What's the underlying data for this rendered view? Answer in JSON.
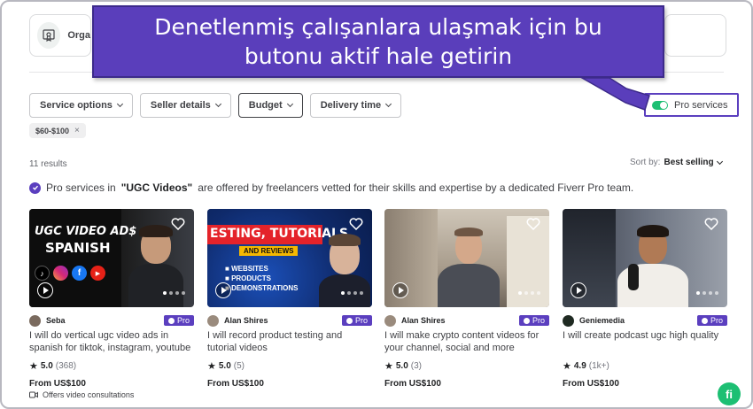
{
  "callout": {
    "line1": "Denetlenmiş çalışanlara ulaşmak için bu",
    "line2": "butonu aktif hale getirin"
  },
  "category_card": {
    "label": "Orga",
    "icon": "certificate-icon"
  },
  "filters": [
    {
      "label": "Service options"
    },
    {
      "label": "Seller details"
    },
    {
      "label": "Budget"
    },
    {
      "label": "Delivery time"
    }
  ],
  "pro_toggle": {
    "label": "Pro services",
    "on": true
  },
  "active_chip": {
    "label": "$60-$100",
    "remove": "×"
  },
  "results_count": "11 results",
  "sort": {
    "prefix": "Sort by:",
    "value": "Best selling"
  },
  "pro_info": {
    "prefix": "Pro services in",
    "category": "\"UGC Videos\"",
    "suffix": "are offered by freelancers vetted for their skills and expertise by a dedicated Fiverr Pro team."
  },
  "gigs": [
    {
      "thumb_text1": "UGC VIDEO AD$",
      "thumb_text2": "SPANISH",
      "seller": "Seba",
      "badge": "Pro",
      "title": "I will do vertical ugc video ads in spanish for tiktok, instagram, youtube",
      "rating": "5.0",
      "reviews": "(368)",
      "price": "From US$100"
    },
    {
      "thumb_text1": "ESTING, TUTORIALS",
      "thumb_text2": "AND REVIEWS",
      "thumb_list": [
        "WEBSITES",
        "PRODUCTS",
        "DEMONSTRATIONS"
      ],
      "seller": "Alan Shires",
      "badge": "Pro",
      "title": "I will record product testing and tutorial videos",
      "rating": "5.0",
      "reviews": "(5)",
      "price": "From US$100"
    },
    {
      "seller": "Alan Shires",
      "badge": "Pro",
      "title": "I will make crypto content videos for your channel, social and more",
      "rating": "5.0",
      "reviews": "(3)",
      "price": "From US$100"
    },
    {
      "seller": "Geniemedia",
      "badge": "Pro",
      "title": "I will create podcast ugc high quality",
      "rating": "4.9",
      "reviews": "(1k+)",
      "price": "From US$100"
    }
  ],
  "consult_text": "Offers video consultations",
  "fab_label": "fi",
  "colors": {
    "pro_purple": "#5b3fbf",
    "fiverr_green": "#1dbf73",
    "callout_bg": "#5a3ebb"
  }
}
